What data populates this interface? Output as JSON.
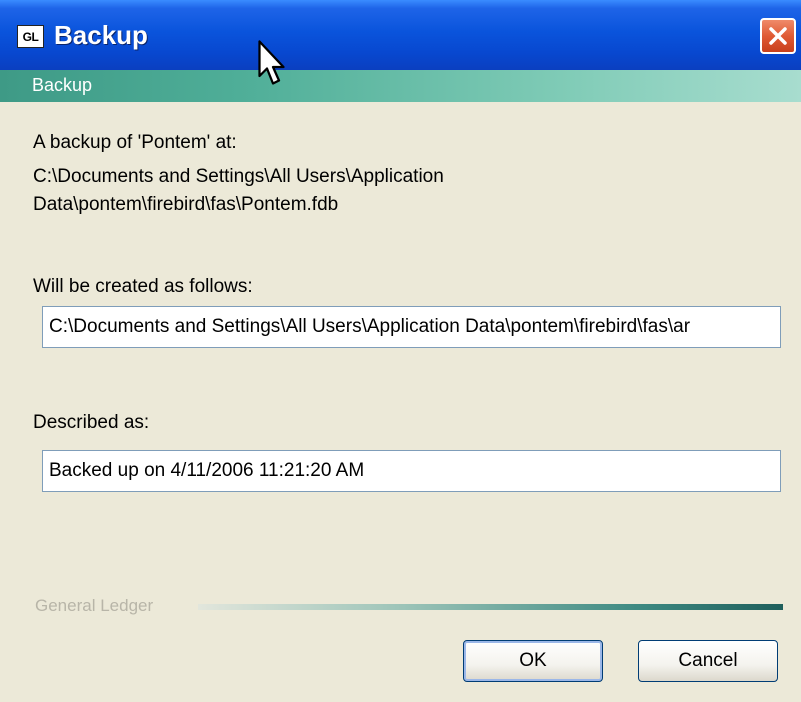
{
  "window": {
    "app_icon_text": "GL",
    "title": "Backup",
    "close_icon": "close-icon"
  },
  "section": {
    "title": "Backup"
  },
  "content": {
    "intro_label": "A backup of 'Pontem' at:",
    "source_path_line1": "C:\\Documents and Settings\\All Users\\Application",
    "source_path_line2": "Data\\pontem\\firebird\\fas\\Pontem.fdb",
    "destination_label": "Will be created as follows:",
    "destination_value": "C:\\Documents and Settings\\All Users\\Application Data\\pontem\\firebird\\fas\\ar",
    "description_label": "Described as:",
    "description_value": "Backed up on 4/11/2006 11:21:20 AM"
  },
  "footer": {
    "module_label": "General Ledger",
    "ok_label": "OK",
    "cancel_label": "Cancel"
  },
  "colors": {
    "titlebar": "#0a54dc",
    "section_band": "#4fae98",
    "window_bg": "#ece9d8",
    "close_button": "#e05a34"
  }
}
